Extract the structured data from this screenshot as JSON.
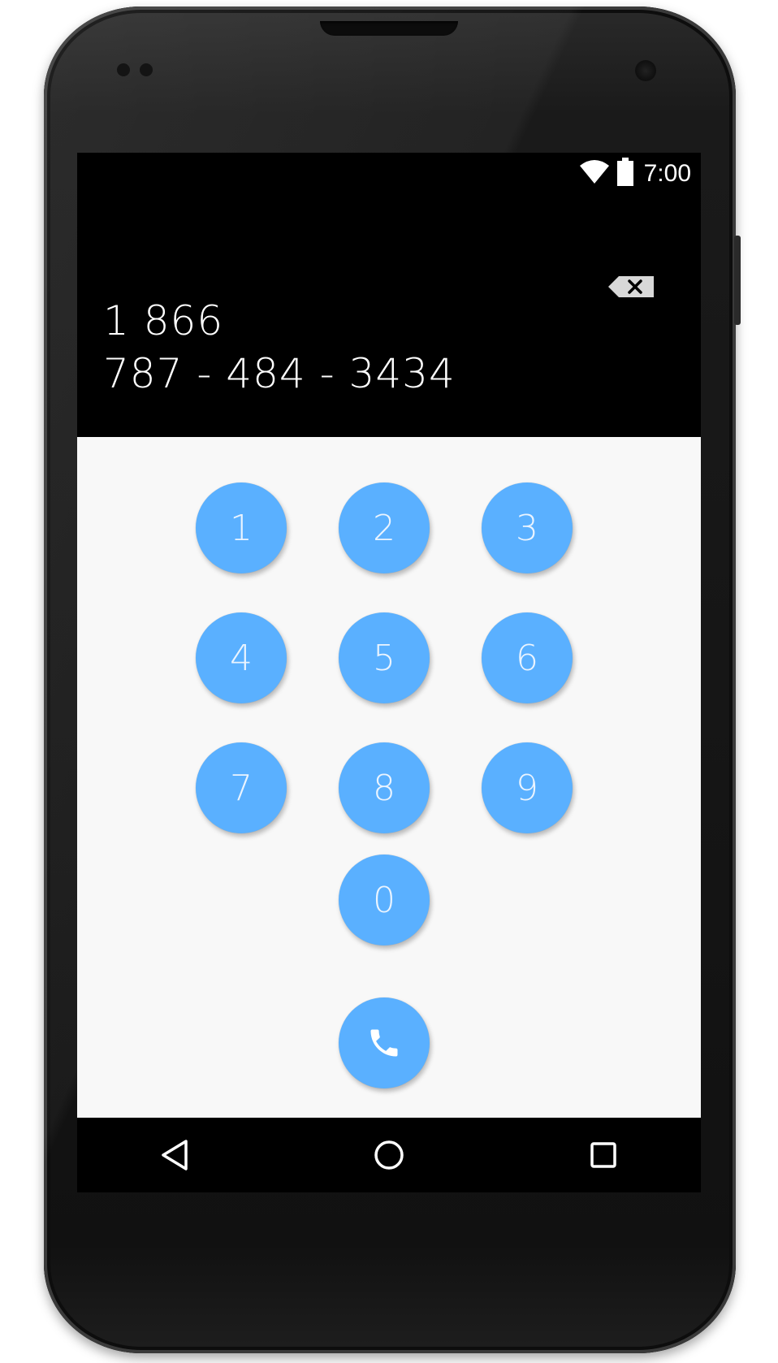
{
  "status_bar": {
    "time": "7:00",
    "icons": [
      "wifi-icon",
      "battery-icon"
    ]
  },
  "dialer": {
    "number_line1": "1 866",
    "number_line2": "787 - 484 - 3434",
    "backspace_icon": "backspace-icon"
  },
  "keypad": {
    "keys": [
      "1",
      "2",
      "3",
      "4",
      "5",
      "6",
      "7",
      "8",
      "9",
      "0"
    ],
    "call_icon": "phone-icon"
  },
  "nav_bar": {
    "icons": [
      "back-icon",
      "home-icon",
      "recents-icon"
    ]
  },
  "colors": {
    "key_background": "#5ab0ff",
    "key_text": "#eaf4ff",
    "keypad_background": "#f8f8f8",
    "display_background": "#000000"
  }
}
